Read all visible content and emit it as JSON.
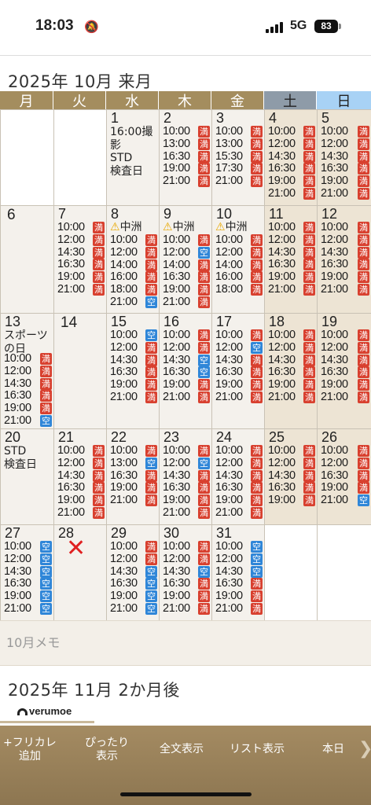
{
  "status_bar": {
    "time": "18:03",
    "network": "5G",
    "battery": "83"
  },
  "month_title": "2025年 10月 来月",
  "next_month_title": "2025年 11月 2か月後",
  "weekdays": [
    "月",
    "火",
    "水",
    "木",
    "金",
    "土",
    "日"
  ],
  "memo": {
    "placeholder": "10月メモ"
  },
  "logo": "verumoe",
  "toolbar": {
    "add_free": [
      "+フリカレ",
      "追加"
    ],
    "exact_view": [
      "ぴったり",
      "表示"
    ],
    "full_text": "全文表示",
    "list_view": "リスト表示",
    "today": "本日"
  },
  "status_labels": {
    "full": "満",
    "available": "空"
  },
  "location_warning": "中洲",
  "weeks": [
    [
      {
        "blank": true
      },
      {
        "blank": true
      },
      {
        "day": "1",
        "note": [
          "16:00撮",
          "影",
          "STD",
          "検査日"
        ]
      },
      {
        "day": "2",
        "slots": [
          [
            "10:00",
            "満"
          ],
          [
            "13:00",
            "満"
          ],
          [
            "16:30",
            "満"
          ],
          [
            "19:00",
            "満"
          ],
          [
            "21:00",
            "満"
          ]
        ]
      },
      {
        "day": "3",
        "slots": [
          [
            "10:00",
            "満"
          ],
          [
            "13:00",
            "満"
          ],
          [
            "15:30",
            "満"
          ],
          [
            "17:30",
            "満"
          ],
          [
            "21:00",
            "満"
          ]
        ]
      },
      {
        "day": "4",
        "slots": [
          [
            "10:00",
            "満"
          ],
          [
            "12:00",
            "満"
          ],
          [
            "14:30",
            "満"
          ],
          [
            "16:30",
            "満"
          ],
          [
            "19:00",
            "満"
          ],
          [
            "21:00",
            "満"
          ]
        ]
      },
      {
        "day": "5",
        "slots": [
          [
            "10:00",
            "満"
          ],
          [
            "12:00",
            "満"
          ],
          [
            "14:30",
            "満"
          ],
          [
            "16:30",
            "満"
          ],
          [
            "19:00",
            "満"
          ],
          [
            "21:00",
            "満"
          ]
        ]
      }
    ],
    [
      {
        "day": "6",
        "big": true
      },
      {
        "day": "7",
        "slots": [
          [
            "10:00",
            "満"
          ],
          [
            "12:00",
            "満"
          ],
          [
            "14:30",
            "満"
          ],
          [
            "16:30",
            "満"
          ],
          [
            "19:00",
            "満"
          ],
          [
            "21:00",
            "満"
          ]
        ]
      },
      {
        "day": "8",
        "warn": true,
        "slots": [
          [
            "10:00",
            "満"
          ],
          [
            "12:00",
            "満"
          ],
          [
            "14:00",
            "満"
          ],
          [
            "16:00",
            "満"
          ],
          [
            "18:00",
            "満"
          ],
          [
            "21:00",
            "空"
          ]
        ]
      },
      {
        "day": "9",
        "warn": true,
        "slots": [
          [
            "10:00",
            "満"
          ],
          [
            "12:00",
            "空"
          ],
          [
            "14:00",
            "満"
          ],
          [
            "16:30",
            "満"
          ],
          [
            "19:00",
            "満"
          ],
          [
            "21:00",
            "満"
          ]
        ]
      },
      {
        "day": "10",
        "warn": true,
        "slots": [
          [
            "10:00",
            "満"
          ],
          [
            "12:00",
            "満"
          ],
          [
            "14:00",
            "満"
          ],
          [
            "16:00",
            "満"
          ],
          [
            "18:00",
            "満"
          ]
        ]
      },
      {
        "day": "11",
        "slots": [
          [
            "10:00",
            "満"
          ],
          [
            "12:00",
            "満"
          ],
          [
            "14:30",
            "満"
          ],
          [
            "16:30",
            "満"
          ],
          [
            "19:00",
            "満"
          ],
          [
            "21:00",
            "満"
          ]
        ]
      },
      {
        "day": "12",
        "slots": [
          [
            "10:00",
            "満"
          ],
          [
            "12:00",
            "満"
          ],
          [
            "14:30",
            "満"
          ],
          [
            "16:30",
            "満"
          ],
          [
            "19:00",
            "満"
          ],
          [
            "21:00",
            "満"
          ]
        ]
      }
    ],
    [
      {
        "day": "13",
        "note": [
          "スポーツ",
          "の日"
        ],
        "slots": [
          [
            "10:00",
            "満"
          ],
          [
            "12:00",
            "満"
          ],
          [
            "14:30",
            "満"
          ],
          [
            "16:30",
            "満"
          ],
          [
            "19:00",
            "満"
          ],
          [
            "21:00",
            "空"
          ]
        ]
      },
      {
        "day": "14",
        "big": true
      },
      {
        "day": "15",
        "slots": [
          [
            "10:00",
            "空"
          ],
          [
            "12:00",
            "満"
          ],
          [
            "14:30",
            "満"
          ],
          [
            "16:30",
            "満"
          ],
          [
            "19:00",
            "満"
          ],
          [
            "21:00",
            "満"
          ]
        ]
      },
      {
        "day": "16",
        "slots": [
          [
            "10:00",
            "満"
          ],
          [
            "12:00",
            "満"
          ],
          [
            "14:30",
            "空"
          ],
          [
            "16:30",
            "空"
          ],
          [
            "19:00",
            "満"
          ],
          [
            "21:00",
            "満"
          ]
        ]
      },
      {
        "day": "17",
        "slots": [
          [
            "10:00",
            "満"
          ],
          [
            "12:00",
            "空"
          ],
          [
            "14:30",
            "満"
          ],
          [
            "16:30",
            "満"
          ],
          [
            "19:00",
            "満"
          ],
          [
            "21:00",
            "満"
          ]
        ]
      },
      {
        "day": "18",
        "slots": [
          [
            "10:00",
            "満"
          ],
          [
            "12:00",
            "満"
          ],
          [
            "14:30",
            "満"
          ],
          [
            "16:30",
            "満"
          ],
          [
            "19:00",
            "満"
          ],
          [
            "21:00",
            "満"
          ]
        ]
      },
      {
        "day": "19",
        "slots": [
          [
            "10:00",
            "満"
          ],
          [
            "12:00",
            "満"
          ],
          [
            "14:30",
            "満"
          ],
          [
            "16:30",
            "満"
          ],
          [
            "19:00",
            "満"
          ],
          [
            "21:00",
            "満"
          ]
        ]
      }
    ],
    [
      {
        "day": "20",
        "note": [
          "STD",
          "検査日"
        ]
      },
      {
        "day": "21",
        "slots": [
          [
            "10:00",
            "満"
          ],
          [
            "12:00",
            "満"
          ],
          [
            "14:30",
            "満"
          ],
          [
            "16:30",
            "満"
          ],
          [
            "19:00",
            "満"
          ],
          [
            "21:00",
            "満"
          ]
        ]
      },
      {
        "day": "22",
        "slots": [
          [
            "10:00",
            "満"
          ],
          [
            "13:00",
            "空"
          ],
          [
            "16:30",
            "満"
          ],
          [
            "19:00",
            "満"
          ],
          [
            "21:00",
            "満"
          ]
        ]
      },
      {
        "day": "23",
        "slots": [
          [
            "10:00",
            "満"
          ],
          [
            "12:00",
            "空"
          ],
          [
            "14:30",
            "満"
          ],
          [
            "16:30",
            "満"
          ],
          [
            "19:00",
            "満"
          ],
          [
            "21:00",
            "満"
          ]
        ]
      },
      {
        "day": "24",
        "slots": [
          [
            "10:00",
            "満"
          ],
          [
            "12:00",
            "満"
          ],
          [
            "14:30",
            "満"
          ],
          [
            "16:30",
            "満"
          ],
          [
            "19:00",
            "満"
          ],
          [
            "21:00",
            "満"
          ]
        ]
      },
      {
        "day": "25",
        "slots": [
          [
            "10:00",
            "満"
          ],
          [
            "12:00",
            "満"
          ],
          [
            "14:30",
            "満"
          ],
          [
            "16:30",
            "満"
          ],
          [
            "19:00",
            "満"
          ]
        ]
      },
      {
        "day": "26",
        "slots": [
          [
            "10:00",
            "満"
          ],
          [
            "12:00",
            "満"
          ],
          [
            "16:30",
            "満"
          ],
          [
            "19:00",
            "満"
          ],
          [
            "21:00",
            "空"
          ]
        ]
      }
    ],
    [
      {
        "day": "27",
        "slots": [
          [
            "10:00",
            "空"
          ],
          [
            "12:00",
            "空"
          ],
          [
            "14:30",
            "空"
          ],
          [
            "16:30",
            "空"
          ],
          [
            "19:00",
            "空"
          ],
          [
            "21:00",
            "空"
          ]
        ]
      },
      {
        "day": "28",
        "closed": true
      },
      {
        "day": "29",
        "slots": [
          [
            "10:00",
            "満"
          ],
          [
            "12:00",
            "満"
          ],
          [
            "14:30",
            "空"
          ],
          [
            "16:30",
            "空"
          ],
          [
            "19:00",
            "空"
          ],
          [
            "21:00",
            "空"
          ]
        ]
      },
      {
        "day": "30",
        "slots": [
          [
            "10:00",
            "満"
          ],
          [
            "12:00",
            "満"
          ],
          [
            "14:30",
            "空"
          ],
          [
            "16:30",
            "満"
          ],
          [
            "19:00",
            "満"
          ],
          [
            "21:00",
            "満"
          ]
        ]
      },
      {
        "day": "31",
        "slots": [
          [
            "10:00",
            "空"
          ],
          [
            "12:00",
            "空"
          ],
          [
            "14:30",
            "空"
          ],
          [
            "16:30",
            "満"
          ],
          [
            "19:00",
            "満"
          ],
          [
            "21:00",
            "満"
          ]
        ]
      },
      {
        "blank": true
      },
      {
        "blank": true
      }
    ]
  ]
}
